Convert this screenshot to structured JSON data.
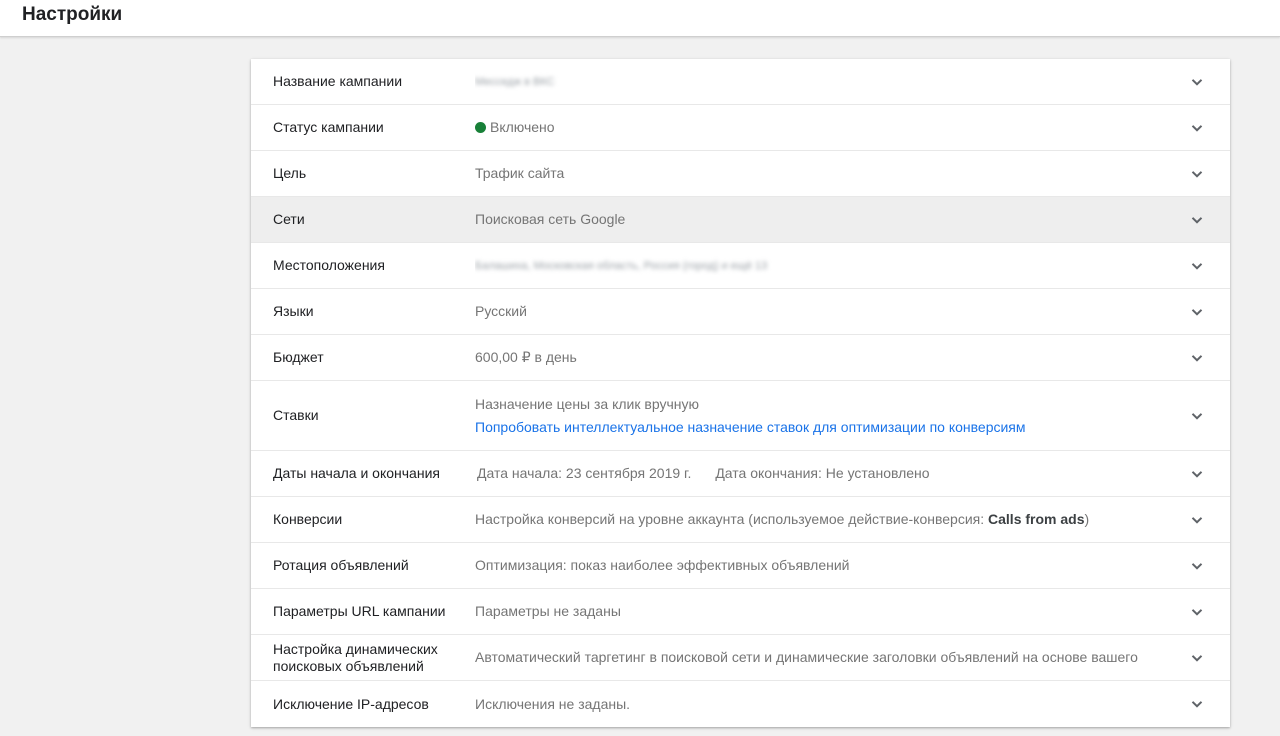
{
  "header": {
    "title": "Настройки"
  },
  "settings": {
    "campaign_name": {
      "label": "Название кампании",
      "value": "Месседж в ВКС"
    },
    "campaign_status": {
      "label": "Статус кампании",
      "value": "Включено",
      "status_color": "#188038"
    },
    "goal": {
      "label": "Цель",
      "value": "Трафик сайта"
    },
    "networks": {
      "label": "Сети",
      "value": "Поисковая сеть Google"
    },
    "locations": {
      "label": "Местоположения",
      "value": "Балашиха, Московская область, Россия (город) и ещё 13"
    },
    "languages": {
      "label": "Языки",
      "value": "Русский"
    },
    "budget": {
      "label": "Бюджет",
      "value": "600,00 ₽ в день"
    },
    "bidding": {
      "label": "Ставки",
      "value": "Назначение цены за клик вручную",
      "link": "Попробовать интеллектуальное назначение ставок для оптимизации по конверсиям"
    },
    "dates": {
      "label": "Даты начала и окончания",
      "start": "Дата начала: 23 сентября 2019 г.",
      "end": "Дата окончания: Не установлено"
    },
    "conversions": {
      "label": "Конверсии",
      "value_prefix": "Настройка конверсий на уровне аккаунта (используемое действие-конверсия: ",
      "value_bold": "Calls from ads",
      "value_suffix": ")"
    },
    "ad_rotation": {
      "label": "Ротация объявлений",
      "value": "Оптимизация: показ наиболее эффективных объявлений"
    },
    "url_params": {
      "label": "Параметры URL кампании",
      "value": "Параметры не заданы"
    },
    "dsa": {
      "label": "Настройка динамических поисковых объявлений",
      "value": "Автоматический таргетинг в поисковой сети и динамические заголовки объявлений на основе вашего"
    },
    "ip_exclusions": {
      "label": "Исключение IP-адресов",
      "value": "Исключения не заданы."
    }
  },
  "icons": {
    "expand": "chevron-down-icon"
  },
  "colors": {
    "link": "#1a73e8",
    "hover_row": "#eeeeee"
  }
}
